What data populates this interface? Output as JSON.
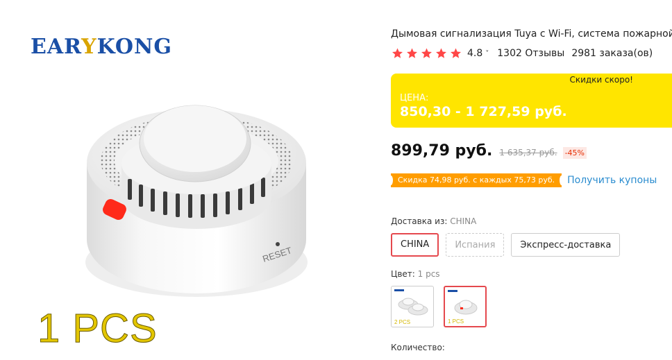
{
  "image": {
    "brand_left": "EAR",
    "brand_accent": "Y",
    "brand_right": "KONG",
    "reset_text": "RESET",
    "pcs_text": "1 PCS"
  },
  "product": {
    "title": "Дымовая сигнализация Tuya с Wi-Fi, система пожарной",
    "rating": "4.8",
    "rating_chevron": "˅",
    "reviews": "1302 Отзывы",
    "orders": "2981 заказа(ов)",
    "star_color": "#ff4747"
  },
  "price_box": {
    "soon": "Скидки скоро!",
    "label": "ЦЕНА:",
    "range": "850,30 - 1 727,59 руб.",
    "bg_color": "#ffe500"
  },
  "price": {
    "current": "899,79 руб.",
    "old": "1 635,37 руб.",
    "discount": "-45%"
  },
  "coupon": {
    "text": "Скидка 74,98 руб. с каждых 75,73 руб.",
    "link": "Получить купоны"
  },
  "shipping": {
    "label": "Доставка из:",
    "value": "CHINA",
    "options": [
      "CHINA",
      "Испания",
      "Экспресс-доставка"
    ]
  },
  "color": {
    "label": "Цвет:",
    "value": "1 pcs",
    "swatches": [
      {
        "text": "2 PCS",
        "icon": "two-detectors-thumbnail"
      },
      {
        "text": "1 PCS",
        "icon": "one-detector-thumbnail"
      }
    ]
  },
  "quantity": {
    "label": "Количество:"
  }
}
